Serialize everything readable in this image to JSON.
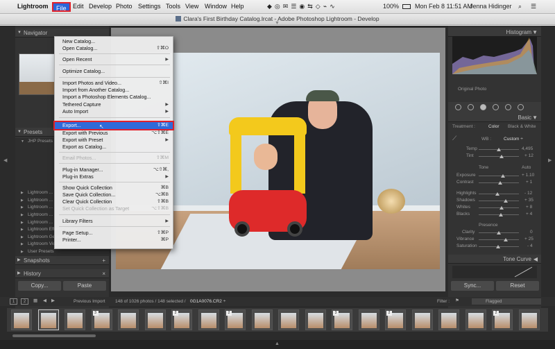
{
  "menubar": {
    "app_name": "Lightroom",
    "items": [
      "File",
      "Edit",
      "Develop",
      "Photo",
      "Settings",
      "Tools",
      "View",
      "Window",
      "Help"
    ],
    "battery": "100%",
    "datetime": "Mon Feb 8  11:51 AM",
    "user": "Jenna Hidinger"
  },
  "window": {
    "title": "Clara's First Birthday Catalog.lrcat - Adobe Photoshop Lightroom - Develop"
  },
  "file_menu": {
    "items": [
      {
        "label": "New Catalog...",
        "shortcut": ""
      },
      {
        "label": "Open Catalog...",
        "shortcut": "⇧⌘O"
      },
      {
        "label": "Open Recent",
        "shortcut": "▶"
      },
      {
        "label": "Optimize Catalog...",
        "shortcut": ""
      },
      {
        "label": "Import Photos and Video...",
        "shortcut": "⇧⌘I"
      },
      {
        "label": "Import from Another Catalog...",
        "shortcut": ""
      },
      {
        "label": "Import a Photoshop Elements Catalog...",
        "shortcut": ""
      },
      {
        "label": "Tethered Capture",
        "shortcut": "▶"
      },
      {
        "label": "Auto Import",
        "shortcut": "▶"
      },
      {
        "label": "Export...",
        "shortcut": "⇧⌘E"
      },
      {
        "label": "Export with Previous",
        "shortcut": "⌥⇧⌘E"
      },
      {
        "label": "Export with Preset",
        "shortcut": "▶"
      },
      {
        "label": "Export as Catalog...",
        "shortcut": ""
      },
      {
        "label": "Email Photos...",
        "shortcut": "⇧⌘M"
      },
      {
        "label": "Plug-in Manager...",
        "shortcut": "⌥⇧⌘,"
      },
      {
        "label": "Plug-in Extras",
        "shortcut": "▶"
      },
      {
        "label": "Show Quick Collection",
        "shortcut": "⌘B"
      },
      {
        "label": "Save Quick Collection...",
        "shortcut": "⌥⌘B"
      },
      {
        "label": "Clear Quick Collection",
        "shortcut": "⇧⌘B"
      },
      {
        "label": "Set Quick Collection as Target",
        "shortcut": "⌥⇧⌘B"
      },
      {
        "label": "Library Filters",
        "shortcut": "▶"
      },
      {
        "label": "Page Setup...",
        "shortcut": "⇧⌘P"
      },
      {
        "label": "Printer...",
        "shortcut": "⌘P"
      }
    ]
  },
  "left_panel": {
    "navigator": "Navigator",
    "presets": "Presets",
    "preset_items": [
      "JHP Presets",
      "",
      "",
      "",
      "",
      "",
      "",
      "Lightroom ...",
      "Lightroom ...",
      "Lightroom ...",
      "Lightroom ...",
      "Lightroom ...",
      "Lightroom Effect Presets",
      "Lightroom General Presets",
      "Lightroom Video Presets",
      "User Presets"
    ],
    "snapshots": "Snapshots",
    "history": "History",
    "copy": "Copy...",
    "paste": "Paste"
  },
  "right_panel": {
    "histogram": "Histogram",
    "original_photo": "Original Photo",
    "basic": "Basic",
    "treatment": "Treatment :",
    "color": "Color",
    "bw": "Black & White",
    "wb": "WB :",
    "wb_value": "Custom ÷",
    "temp_label": "Temp",
    "temp_value": "4,495",
    "tint_label": "Tint",
    "tint_value": "+ 12",
    "tone": "Tone",
    "auto": "Auto",
    "sliders": [
      {
        "label": "Exposure",
        "value": "+ 1.10"
      },
      {
        "label": "Contrast",
        "value": "+ 1"
      },
      {
        "label": "Highlights",
        "value": "- 12"
      },
      {
        "label": "Shadows",
        "value": "+ 35"
      },
      {
        "label": "Whites",
        "value": "+ 8"
      },
      {
        "label": "Blacks",
        "value": "+ 4"
      }
    ],
    "presence": "Presence",
    "presence_sliders": [
      {
        "label": "Clarity",
        "value": "0"
      },
      {
        "label": "Vibrance",
        "value": "+ 25"
      },
      {
        "label": "Saturation",
        "value": "- 4"
      }
    ],
    "tone_curve": "Tone Curve",
    "sync": "Sync...",
    "reset": "Reset"
  },
  "filmstrip": {
    "source": "Previous Import",
    "count": "148 of 1026 photos / 148 selected /",
    "filename": "0G1A0076.CR2 ÷",
    "filter_label": "Filter :",
    "filter_value": "Flagged",
    "page1": "1",
    "page2": "2",
    "thumb_badges": [
      "",
      "",
      "",
      "3",
      "",
      "",
      "2",
      "",
      "2",
      "",
      "",
      "",
      "3",
      "",
      "2",
      "",
      "",
      "",
      "2",
      ""
    ]
  },
  "colors": {
    "highlight": "#2f6ad9",
    "annotation": "#e0202a",
    "panel": "#333333"
  }
}
